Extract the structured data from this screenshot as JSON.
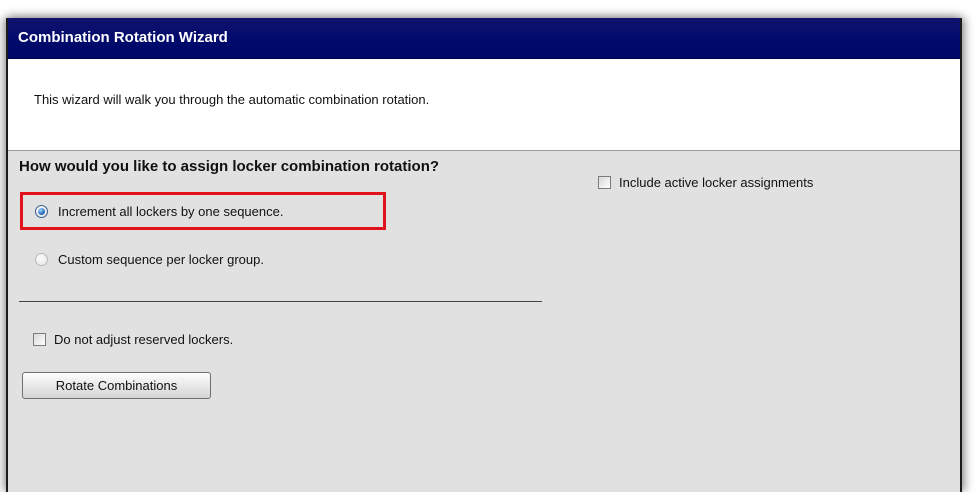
{
  "window": {
    "title": "Combination Rotation Wizard"
  },
  "intro": {
    "text": "This wizard will walk you through the automatic combination rotation."
  },
  "form": {
    "question": "How would you like to assign locker combination rotation?",
    "options": [
      {
        "label": "Increment all lockers by one sequence.",
        "selected": true
      },
      {
        "label": "Custom sequence per locker group.",
        "selected": false
      }
    ],
    "include_active_label": "Include active locker assignments",
    "include_active_checked": false,
    "reserved_label": "Do not adjust reserved lockers.",
    "reserved_checked": false,
    "submit_label": "Rotate Combinations"
  },
  "colors": {
    "titlebar": "#000a6b",
    "panel": "#e1e1e1",
    "highlight": "#e2121c"
  }
}
